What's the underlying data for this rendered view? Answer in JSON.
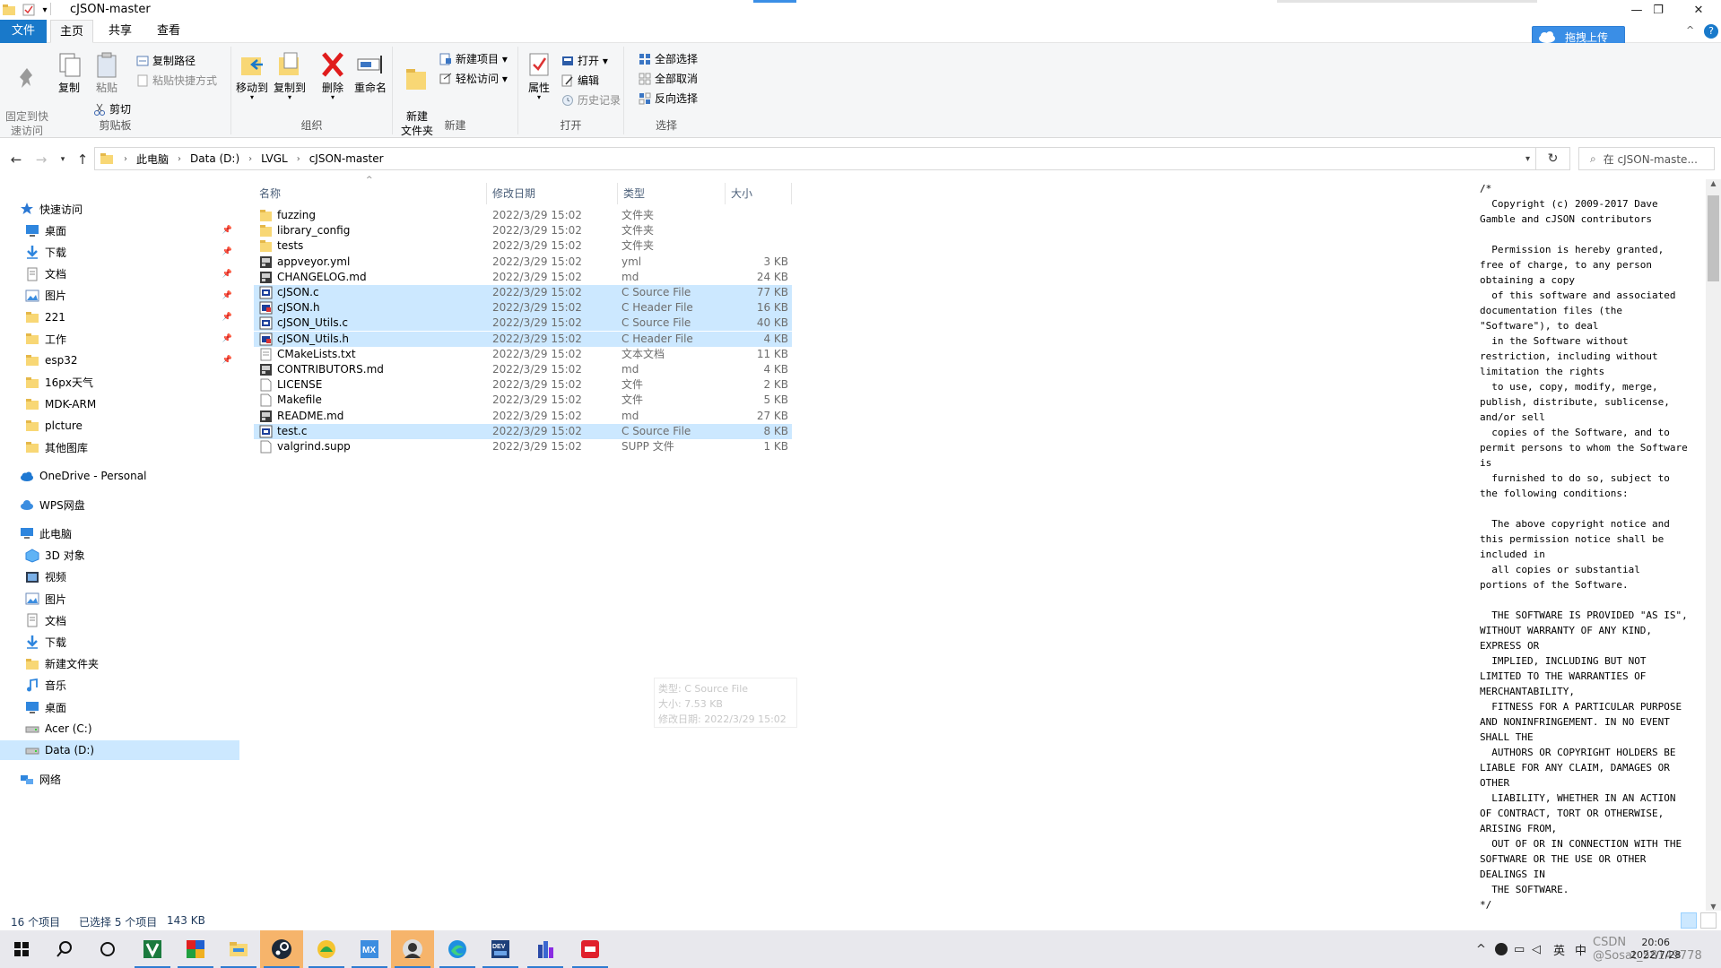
{
  "window": {
    "title": "cJSON-master",
    "min_glyph": "—",
    "max_glyph": "❐",
    "close_glyph": "✕"
  },
  "ribbon_tabs": [
    "文件",
    "主页",
    "共享",
    "查看"
  ],
  "upload_button": "拖拽上传",
  "ribbon": {
    "clipboard": {
      "label": "剪贴板",
      "pin": "固定到快\n速访问",
      "copy": "复制",
      "paste": "粘贴",
      "copy_path": "复制路径",
      "paste_shortcut": "粘贴快捷方式",
      "cut": "剪切"
    },
    "organize": {
      "label": "组织",
      "move_to": "移动到",
      "copy_to": "复制到",
      "delete": "删除",
      "rename": "重命名"
    },
    "new": {
      "label": "新建",
      "new_folder": "新建\n文件夹",
      "new_item": "新建项目 ▾",
      "easy_access": "轻松访问 ▾"
    },
    "open": {
      "label": "打开",
      "properties": "属性",
      "open": "打开 ▾",
      "edit": "编辑",
      "history": "历史记录"
    },
    "select": {
      "label": "选择",
      "select_all": "全部选择",
      "select_none": "全部取消",
      "invert": "反向选择"
    }
  },
  "address": {
    "crumbs": [
      "此电脑",
      "Data (D:)",
      "LVGL",
      "cJSON-master"
    ],
    "search_placeholder": "在 cJSON-maste..."
  },
  "nav_pane": {
    "quick_access": "快速访问",
    "quick_items": [
      {
        "label": "桌面",
        "pinned": true,
        "icon": "desktop-icon"
      },
      {
        "label": "下载",
        "pinned": true,
        "icon": "download-icon"
      },
      {
        "label": "文档",
        "pinned": true,
        "icon": "document-icon"
      },
      {
        "label": "图片",
        "pinned": true,
        "icon": "picture-icon"
      },
      {
        "label": "221",
        "pinned": true,
        "icon": "folder-icon"
      },
      {
        "label": "工作",
        "pinned": true,
        "icon": "folder-icon"
      },
      {
        "label": "esp32",
        "pinned": true,
        "icon": "folder-icon"
      },
      {
        "label": "16px天气",
        "pinned": false,
        "icon": "folder-icon"
      },
      {
        "label": "MDK-ARM",
        "pinned": false,
        "icon": "folder-icon"
      },
      {
        "label": "plcture",
        "pinned": false,
        "icon": "folder-icon"
      },
      {
        "label": "其他图库",
        "pinned": false,
        "icon": "folder-icon"
      }
    ],
    "onedrive": "OneDrive - Personal",
    "wps": "WPS网盘",
    "this_pc": "此电脑",
    "pc_items": [
      {
        "label": "3D 对象",
        "icon": "3d-objects-icon"
      },
      {
        "label": "视频",
        "icon": "video-icon"
      },
      {
        "label": "图片",
        "icon": "picture-icon"
      },
      {
        "label": "文档",
        "icon": "document-icon"
      },
      {
        "label": "下载",
        "icon": "download-icon"
      },
      {
        "label": "新建文件夹",
        "icon": "folder-icon"
      },
      {
        "label": "音乐",
        "icon": "music-icon"
      },
      {
        "label": "桌面",
        "icon": "desktop-icon"
      },
      {
        "label": "Acer (C:)",
        "icon": "drive-icon"
      },
      {
        "label": "Data (D:)",
        "icon": "drive-icon"
      }
    ],
    "network": "网络"
  },
  "columns": {
    "name": "名称",
    "date": "修改日期",
    "type": "类型",
    "size": "大小"
  },
  "files": [
    {
      "name": "fuzzing",
      "date": "2022/3/29 15:02",
      "type": "文件夹",
      "size": "",
      "kind": "folder",
      "selected": false
    },
    {
      "name": "library_config",
      "date": "2022/3/29 15:02",
      "type": "文件夹",
      "size": "",
      "kind": "folder",
      "selected": false
    },
    {
      "name": "tests",
      "date": "2022/3/29 15:02",
      "type": "文件夹",
      "size": "",
      "kind": "folder",
      "selected": false
    },
    {
      "name": "appveyor.yml",
      "date": "2022/3/29 15:02",
      "type": "yml",
      "size": "3 KB",
      "kind": "app",
      "selected": false
    },
    {
      "name": "CHANGELOG.md",
      "date": "2022/3/29 15:02",
      "type": "md",
      "size": "24 KB",
      "kind": "app",
      "selected": false
    },
    {
      "name": "cJSON.c",
      "date": "2022/3/29 15:02",
      "type": "C Source File",
      "size": "77 KB",
      "kind": "code",
      "selected": true
    },
    {
      "name": "cJSON.h",
      "date": "2022/3/29 15:02",
      "type": "C Header File",
      "size": "16 KB",
      "kind": "header",
      "selected": true
    },
    {
      "name": "cJSON_Utils.c",
      "date": "2022/3/29 15:02",
      "type": "C Source File",
      "size": "40 KB",
      "kind": "code",
      "selected": true
    },
    {
      "name": "cJSON_Utils.h",
      "date": "2022/3/29 15:02",
      "type": "C Header File",
      "size": "4 KB",
      "kind": "header",
      "selected": true
    },
    {
      "name": "CMakeLists.txt",
      "date": "2022/3/29 15:02",
      "type": "文本文档",
      "size": "11 KB",
      "kind": "text",
      "selected": false
    },
    {
      "name": "CONTRIBUTORS.md",
      "date": "2022/3/29 15:02",
      "type": "md",
      "size": "4 KB",
      "kind": "app",
      "selected": false
    },
    {
      "name": "LICENSE",
      "date": "2022/3/29 15:02",
      "type": "文件",
      "size": "2 KB",
      "kind": "blank",
      "selected": false
    },
    {
      "name": "Makefile",
      "date": "2022/3/29 15:02",
      "type": "文件",
      "size": "5 KB",
      "kind": "blank",
      "selected": false
    },
    {
      "name": "README.md",
      "date": "2022/3/29 15:02",
      "type": "md",
      "size": "27 KB",
      "kind": "app",
      "selected": false
    },
    {
      "name": "test.c",
      "date": "2022/3/29 15:02",
      "type": "C Source File",
      "size": "8 KB",
      "kind": "code",
      "selected": true
    },
    {
      "name": "valgrind.supp",
      "date": "2022/3/29 15:02",
      "type": "SUPP 文件",
      "size": "1 KB",
      "kind": "blank",
      "selected": false
    }
  ],
  "tooltip_ghost": [
    "类型: C Source File",
    "大小: 7.53 KB",
    "修改日期: 2022/3/29 15:02"
  ],
  "preview_text": "/*\n  Copyright (c) 2009-2017 Dave\nGamble and cJSON contributors\n\n  Permission is hereby granted,\nfree of charge, to any person\nobtaining a copy\n  of this software and associated\ndocumentation files (the\n\"Software\"), to deal\n  in the Software without\nrestriction, including without\nlimitation the rights\n  to use, copy, modify, merge,\npublish, distribute, sublicense,\nand/or sell\n  copies of the Software, and to\npermit persons to whom the Software\nis\n  furnished to do so, subject to\nthe following conditions:\n\n  The above copyright notice and\nthis permission notice shall be\nincluded in\n  all copies or substantial\nportions of the Software.\n\n  THE SOFTWARE IS PROVIDED \"AS IS\",\nWITHOUT WARRANTY OF ANY KIND,\nEXPRESS OR\n  IMPLIED, INCLUDING BUT NOT\nLIMITED TO THE WARRANTIES OF\nMERCHANTABILITY,\n  FITNESS FOR A PARTICULAR PURPOSE\nAND NONINFRINGEMENT. IN NO EVENT\nSHALL THE\n  AUTHORS OR COPYRIGHT HOLDERS BE\nLIABLE FOR ANY CLAIM, DAMAGES OR\nOTHER\n  LIABILITY, WHETHER IN AN ACTION\nOF CONTRACT, TORT OR OTHERWISE,\nARISING FROM,\n  OUT OF OR IN CONNECTION WITH THE\nSOFTWARE OR THE USE OR OTHER\nDEALINGS IN\n  THE SOFTWARE.\n*/",
  "status": {
    "count": "16 个项目",
    "selected": "已选择 5 个项目",
    "size": "143 KB"
  },
  "taskbar": {
    "apps": [
      "windows-start",
      "search",
      "cortana",
      "app-v",
      "app-multicolor",
      "file-explorer",
      "steam",
      "app-green",
      "app-mx",
      "app-avatar",
      "edge",
      "devcpp",
      "app-building",
      "youdao"
    ],
    "tray": {
      "ime1": "英",
      "ime2": "中",
      "time": "20:06",
      "date": "2022/7/28",
      "overlay": "CSDN @Sosat_58149778"
    }
  },
  "colors": {
    "accent": "#1979ca",
    "selected_row": "#cce8ff",
    "folder": "#f8d775"
  }
}
